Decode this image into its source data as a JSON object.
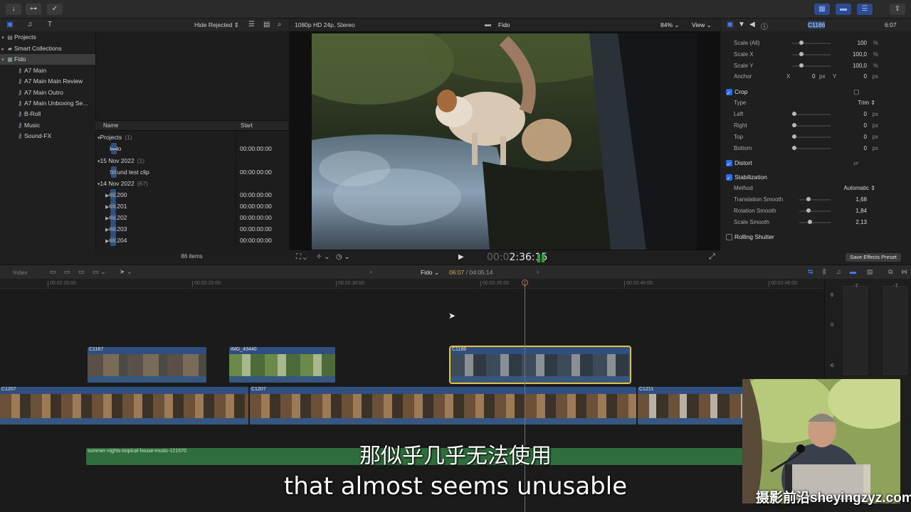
{
  "sidebar": {
    "items": [
      {
        "label": "Projects",
        "level": 0
      },
      {
        "label": "Smart Collections",
        "level": 0
      },
      {
        "label": "Fido",
        "level": 0
      },
      {
        "label": "A7 Main",
        "level": 1
      },
      {
        "label": "A7 Main Main Review",
        "level": 1
      },
      {
        "label": "A7 Main Outro",
        "level": 1
      },
      {
        "label": "A7 Main Unboxing Se...",
        "level": 1
      },
      {
        "label": "B-Roll",
        "level": 1
      },
      {
        "label": "Music",
        "level": 1
      },
      {
        "label": "Sound-FX",
        "level": 1
      }
    ]
  },
  "browser": {
    "filter_label": "Hide Rejected",
    "col_name": "Name",
    "col_start": "Start",
    "rows": [
      {
        "name": "Projects",
        "count": "(1)",
        "start": "",
        "kind": "group"
      },
      {
        "name": "Fido",
        "count": "",
        "start": "00:00:00:00",
        "kind": "item"
      },
      {
        "name": "15 Nov 2022",
        "count": "(1)",
        "start": "",
        "kind": "group"
      },
      {
        "name": "Sound test clip",
        "count": "",
        "start": "00:00:00:00",
        "kind": "item"
      },
      {
        "name": "14 Nov 2022",
        "count": "(67)",
        "start": "",
        "kind": "group"
      },
      {
        "name": "C1200",
        "count": "",
        "start": "00:00:00:00",
        "kind": "clip"
      },
      {
        "name": "C1201",
        "count": "",
        "start": "00:00:00:00",
        "kind": "clip"
      },
      {
        "name": "C1202",
        "count": "",
        "start": "00:00:00:00",
        "kind": "clip"
      },
      {
        "name": "C1203",
        "count": "",
        "start": "00:00:00:00",
        "kind": "clip"
      },
      {
        "name": "C1204",
        "count": "",
        "start": "00:00:00:00",
        "kind": "clip"
      }
    ],
    "items_count": "86 items"
  },
  "viewer": {
    "format": "1080p HD 24p, Stereo",
    "title": "Fido",
    "zoom": "84%",
    "view_label": "View",
    "timecode_dim": "00:0",
    "timecode": "2:36:15"
  },
  "inspector": {
    "clip_name": "C1186",
    "duration": "6:07",
    "rows": [
      {
        "label": "Scale (All)",
        "value": "100",
        "unit": "%"
      },
      {
        "label": "Scale X",
        "value": "100,0",
        "unit": "%"
      },
      {
        "label": "Scale Y",
        "value": "100,0",
        "unit": "%"
      }
    ],
    "anchor": {
      "label": "Anchor",
      "x_label": "X",
      "x_val": "0",
      "x_unit": "px",
      "y_label": "Y",
      "y_val": "0",
      "y_unit": "px"
    },
    "crop": {
      "label": "Crop",
      "type_label": "Type",
      "type_value": "Trim"
    },
    "crop_rows": [
      {
        "label": "Left",
        "value": "0",
        "unit": "px"
      },
      {
        "label": "Right",
        "value": "0",
        "unit": "px"
      },
      {
        "label": "Top",
        "value": "0",
        "unit": "px"
      },
      {
        "label": "Bottom",
        "value": "0",
        "unit": "px"
      }
    ],
    "distort": "Distort",
    "stabilization": "Stabilization",
    "method_label": "Method",
    "method_value": "Automatic",
    "stab_rows": [
      {
        "label": "Translation Smooth",
        "value": "1,68"
      },
      {
        "label": "Rotation Smooth",
        "value": "1,84"
      },
      {
        "label": "Scale Smooth",
        "value": "2,13"
      }
    ],
    "rolling_shutter": "Rolling Shutter",
    "save_preset": "Save Effects Preset"
  },
  "timeline": {
    "index_label": "Index",
    "project": "Fido",
    "tc_current": "06:07",
    "tc_total": "/ 04:05:14",
    "ruler": [
      "00:02:20:00",
      "00:02:25:00",
      "00:02:30:00",
      "00:02:35:00",
      "00:02:40:00",
      "00:02:45:00"
    ],
    "connected_clips": [
      "C1167",
      "IMG_43440",
      "C1186"
    ],
    "primary_clips": [
      "C1207",
      "C1207",
      "C1211"
    ],
    "audio_clip": "summer-nights-tropical-house-music-121570",
    "meter_labels": [
      "6",
      "0",
      "-6"
    ],
    "meter_peaks": [
      "-7",
      "-7"
    ]
  },
  "subtitles": {
    "cn": "那似乎几乎无法使用",
    "en": "that almost seems unusable"
  },
  "watermark": "摄影前沿sheyingzyz.com"
}
